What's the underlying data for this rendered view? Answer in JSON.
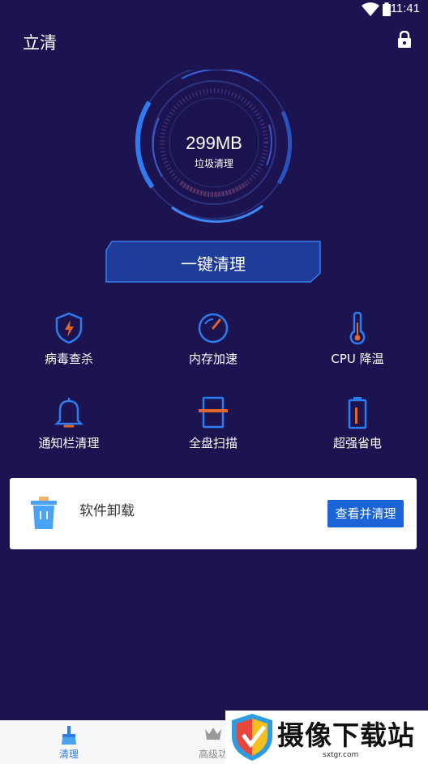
{
  "status": {
    "time": "11:41"
  },
  "header": {
    "title": "立清"
  },
  "gauge": {
    "value": "299MB",
    "label": "垃圾清理"
  },
  "main": {
    "clean_button_label": "一键清理"
  },
  "features": [
    {
      "label": "病毒查杀",
      "icon": "shield-bolt-icon"
    },
    {
      "label": "内存加速",
      "icon": "speedometer-icon"
    },
    {
      "label": "CPU 降温",
      "icon": "thermometer-icon"
    },
    {
      "label": "通知栏清理",
      "icon": "bell-icon"
    },
    {
      "label": "全盘扫描",
      "icon": "scan-icon"
    },
    {
      "label": "超强省电",
      "icon": "battery-icon"
    }
  ],
  "card": {
    "title": "软件卸载",
    "button_label": "查看并清理",
    "icon": "trash-can-icon"
  },
  "bottom_nav": [
    {
      "label": "清理",
      "icon": "broom-icon",
      "active": true
    },
    {
      "label": "高级功",
      "icon": "crown-icon",
      "active": false
    }
  ],
  "watermark": {
    "text": "摄像下载站",
    "url": "sxtgr.com"
  },
  "colors": {
    "background": "#1b1450",
    "accent": "#2f7cf0",
    "button": "#1a64d8"
  }
}
